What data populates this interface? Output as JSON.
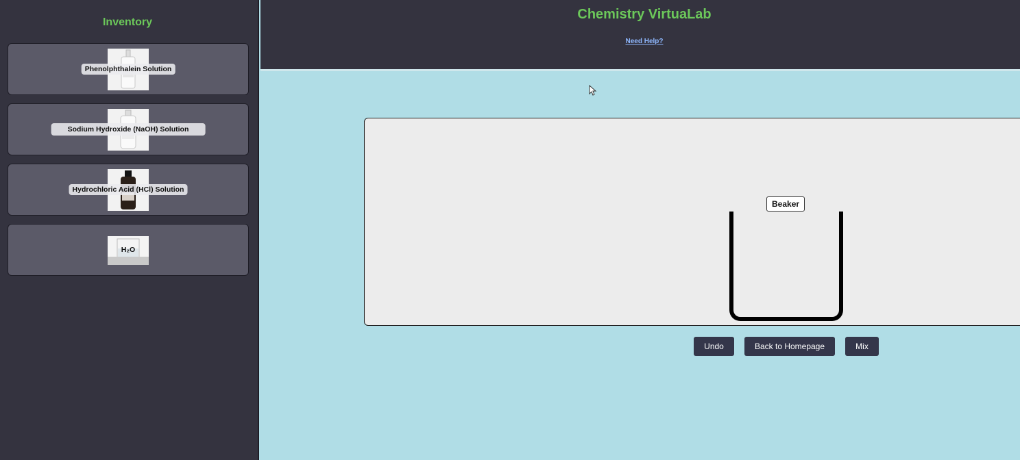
{
  "sidebar": {
    "title": "Inventory",
    "items": [
      {
        "label": "Phenolphthalein Solution",
        "icon": "clear-bottle-icon"
      },
      {
        "label": "Sodium Hydroxide (NaOH) Solution",
        "icon": "clear-bottle-icon"
      },
      {
        "label": "Hydrochloric Acid (HCl) Solution",
        "icon": "dark-bottle-icon"
      },
      {
        "label": "H₂O",
        "icon": "water-beaker-icon"
      }
    ]
  },
  "header": {
    "title": "Chemistry VirtuaLab",
    "help_link": "Need Help?"
  },
  "workbench": {
    "beaker_label": "Beaker"
  },
  "controls": {
    "undo": "Undo",
    "back": "Back to Homepage",
    "mix": "Mix"
  },
  "colors": {
    "accent_green": "#6cc85a",
    "panel_dark": "#34333f",
    "workspace_bg": "#b0dde6",
    "link_blue": "#8fb8ff"
  }
}
